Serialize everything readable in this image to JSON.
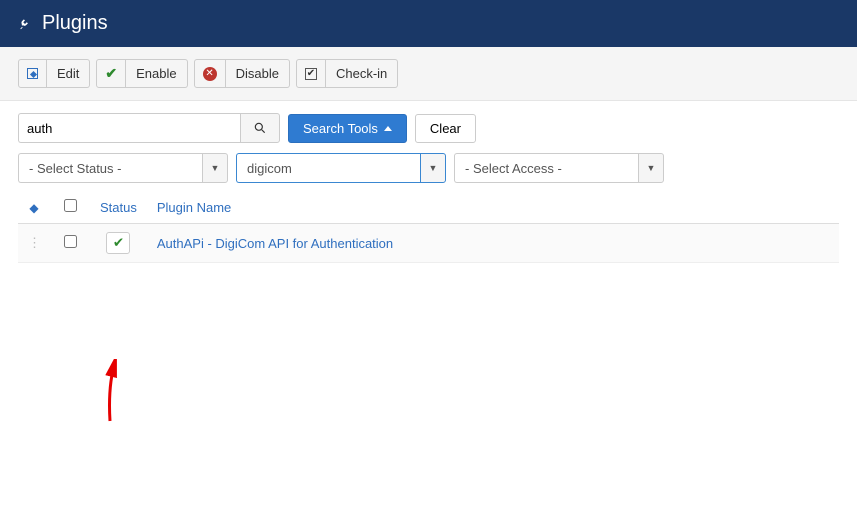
{
  "header": {
    "title": "Plugins"
  },
  "toolbar": {
    "edit": "Edit",
    "enable": "Enable",
    "disable": "Disable",
    "checkin": "Check-in"
  },
  "search": {
    "value": "auth",
    "tools_label": "Search Tools",
    "clear_label": "Clear"
  },
  "filters": {
    "status": "- Select Status -",
    "folder": "digicom",
    "access": "- Select Access -"
  },
  "table": {
    "columns": {
      "status": "Status",
      "name": "Plugin Name"
    },
    "rows": [
      {
        "status_enabled": true,
        "name": "AuthAPi - DigiCom API for Authentication"
      }
    ]
  }
}
